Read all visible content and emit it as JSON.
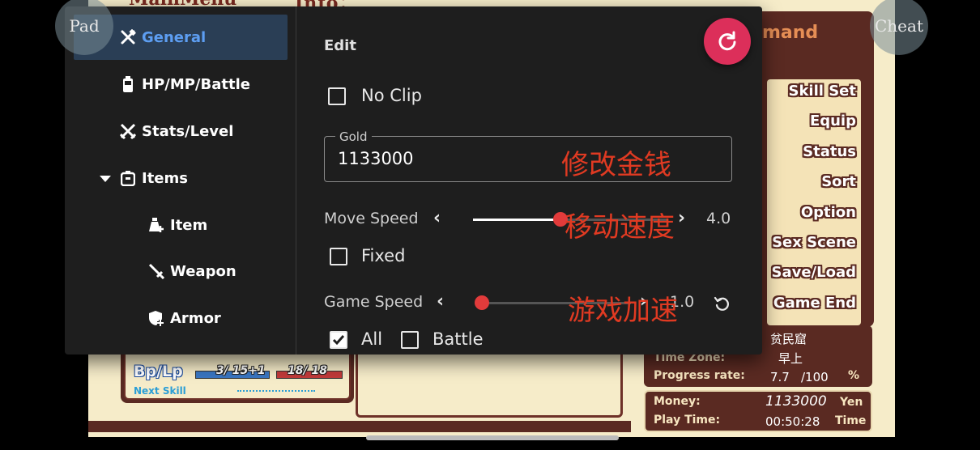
{
  "game": {
    "main_menu_title": "MainMenu",
    "info_bar": "Info：",
    "command_title": "mand",
    "commands": [
      "Skill Set",
      "Equip",
      "Status",
      "Sort",
      "Option",
      "Sex Scene",
      "Save/Load",
      "Game End"
    ],
    "location": "贫民窟",
    "time_zone_label": "Time Zone:",
    "time_zone_value": "早上",
    "progress_label": "Progress rate:",
    "progress_value": "7.7",
    "progress_max": "/100",
    "progress_unit": "%",
    "money_label": "Money:",
    "money_value": "1133000",
    "money_unit": "Yen",
    "play_time_label": "Play Time:",
    "play_time_value": "00:50:28",
    "play_time_unit": "Time",
    "bp_lp_label": "Bp/Lp",
    "bp_value": "3/ 15+1",
    "lp_value": "18/ 18",
    "next_skill_label": "Next Skill"
  },
  "overlay": {
    "pad_label": "Pad",
    "cheat_label": "Cheat"
  },
  "sidebar": {
    "items": [
      {
        "label": "General",
        "icon": "tools-icon",
        "active": true
      },
      {
        "label": "HP/MP/Battle",
        "icon": "battery-icon"
      },
      {
        "label": "Stats/Level",
        "icon": "crossed-swords-icon"
      },
      {
        "label": "Items",
        "icon": "bag-icon",
        "expanded": true
      },
      {
        "label": "Item",
        "icon": "potion-icon"
      },
      {
        "label": "Weapon",
        "icon": "sword-icon"
      },
      {
        "label": "Armor",
        "icon": "shield-icon"
      }
    ]
  },
  "edit": {
    "title": "Edit",
    "no_clip_label": "No Clip",
    "no_clip_checked": false,
    "gold_label": "Gold",
    "gold_value": "1133000",
    "gold_annotation": "修改金钱",
    "move_speed_label": "Move Speed",
    "move_speed_value": "4.0",
    "move_speed_fraction": 0.45,
    "move_speed_annotation": "移动速度",
    "fixed_label": "Fixed",
    "fixed_checked": false,
    "game_speed_label": "Game Speed",
    "game_speed_value": "1.0",
    "game_speed_fraction": 0.0,
    "game_speed_annotation": "游戏加速",
    "all_label": "All",
    "all_checked": true,
    "battle_label": "Battle",
    "battle_checked": false
  },
  "colors": {
    "accent": "#5d9ef2",
    "fab": "#dc2f5a",
    "thumb": "#e23b3b",
    "annotation": "#e03a22"
  }
}
